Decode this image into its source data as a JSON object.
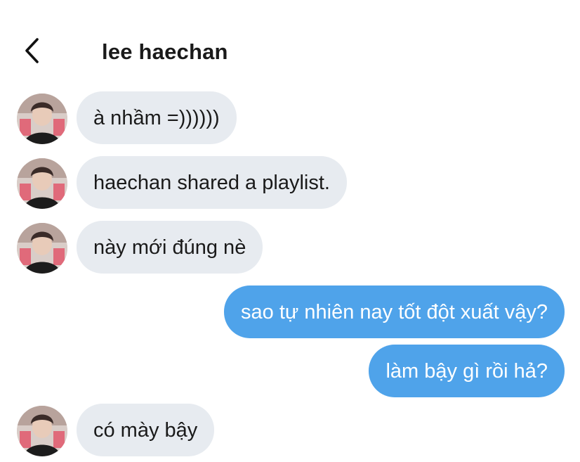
{
  "header": {
    "back_icon": "chevron-left-icon",
    "title": "lee haechan"
  },
  "messages": [
    {
      "from": "incoming",
      "text": "à nhầm =))))))"
    },
    {
      "from": "incoming",
      "text": "haechan shared a playlist."
    },
    {
      "from": "incoming",
      "text": "này mới đúng nè"
    },
    {
      "from": "outgoing",
      "text": "sao tự nhiên nay tốt đột xuất vậy?"
    },
    {
      "from": "outgoing",
      "text": "làm bậy gì rồi hả?"
    },
    {
      "from": "incoming",
      "text": "có mày bậy"
    }
  ],
  "colors": {
    "incoming_bubble": "#e7ebf0",
    "outgoing_bubble": "#4fa3ea",
    "outgoing_text": "#ffffff",
    "text": "#1a1a1a"
  }
}
